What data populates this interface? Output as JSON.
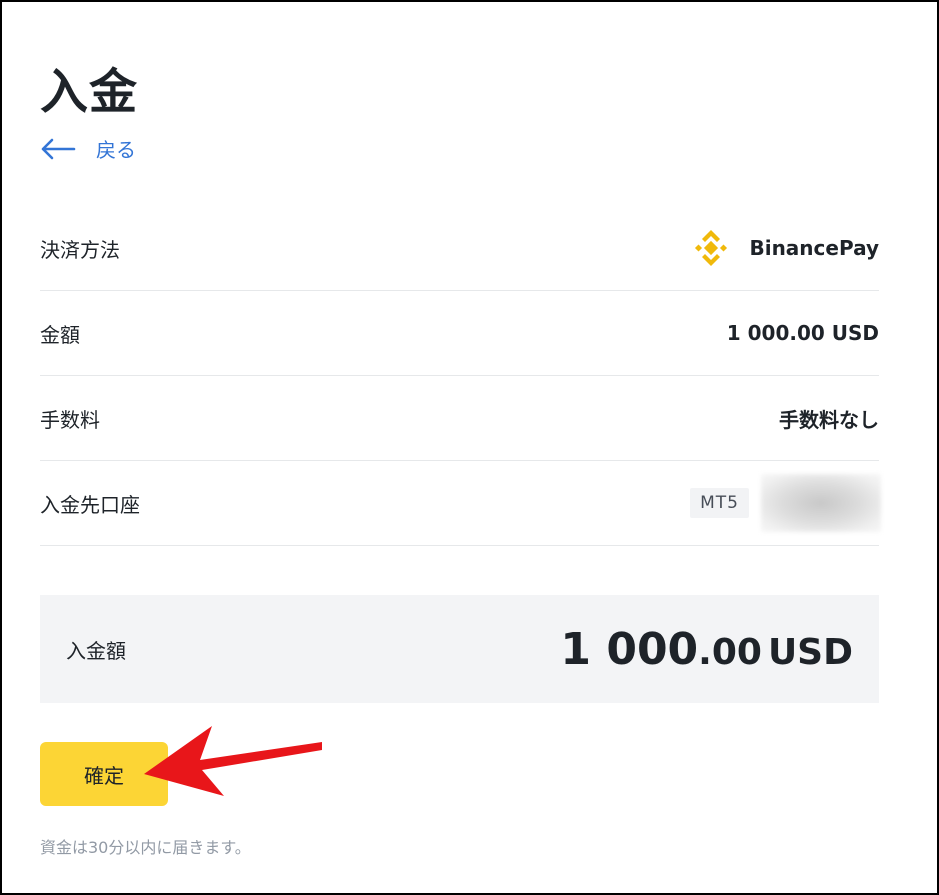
{
  "page": {
    "title": "入金",
    "back_label": "戻る"
  },
  "rows": {
    "method": {
      "label": "決済方法",
      "value": "BinancePay",
      "icon": "binance-logo"
    },
    "amount": {
      "label": "金額",
      "value": "1 000.00 USD"
    },
    "fee": {
      "label": "手数料",
      "value": "手数料なし"
    },
    "account": {
      "label": "入金先口座",
      "badge": "MT5"
    }
  },
  "total": {
    "label": "入金額",
    "integer": "1 000",
    "decimal": ".00",
    "currency": "USD"
  },
  "confirm": {
    "label": "確定"
  },
  "note": "資金は30分以内に届きます。",
  "colors": {
    "accent_yellow": "#FCD535",
    "link_blue": "#3375D6",
    "annotation_red": "#E8161A",
    "binance_gold": "#F0B90B"
  }
}
